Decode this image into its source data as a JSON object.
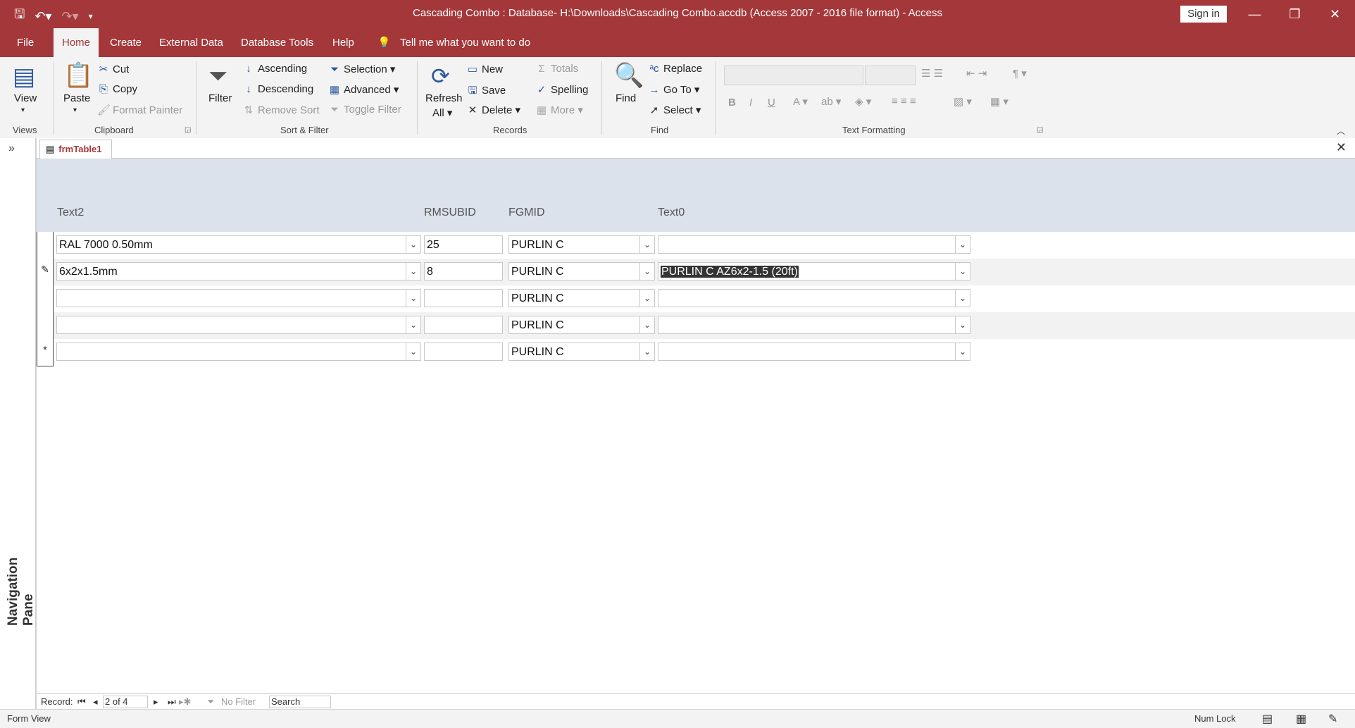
{
  "window": {
    "title": "Cascading Combo : Database- H:\\Downloads\\Cascading Combo.accdb (Access 2007 - 2016 file format)  -  Access",
    "sign_in": "Sign in"
  },
  "menu": {
    "file": "File",
    "home": "Home",
    "create": "Create",
    "external_data": "External Data",
    "database_tools": "Database Tools",
    "help": "Help",
    "tell_me": "Tell me what you want to do"
  },
  "ribbon": {
    "views": {
      "view": "View",
      "label": "Views"
    },
    "clipboard": {
      "paste": "Paste",
      "cut": "Cut",
      "copy": "Copy",
      "format_painter": "Format Painter",
      "label": "Clipboard"
    },
    "sort_filter": {
      "filter": "Filter",
      "ascending": "Ascending",
      "descending": "Descending",
      "remove_sort": "Remove Sort",
      "selection": "Selection",
      "advanced": "Advanced",
      "toggle_filter": "Toggle Filter",
      "label": "Sort & Filter"
    },
    "records": {
      "refresh": "Refresh",
      "refresh_all": "All",
      "new": "New",
      "save": "Save",
      "delete": "Delete",
      "totals": "Totals",
      "spelling": "Spelling",
      "more": "More",
      "label": "Records"
    },
    "find": {
      "find": "Find",
      "replace": "Replace",
      "goto": "Go To",
      "select": "Select",
      "label": "Find"
    },
    "text_formatting": {
      "label": "Text Formatting"
    }
  },
  "nav_pane": {
    "label": "Navigation Pane"
  },
  "document": {
    "tab": "frmTable1"
  },
  "form": {
    "headers": [
      "Text2",
      "RMSUBID",
      "FGMID",
      "Text0"
    ],
    "rows": [
      {
        "selector": "",
        "text2": "RAL 7000 0.50mm",
        "rmsubid": "25",
        "fgmid": "PURLIN C",
        "text0": ""
      },
      {
        "selector": "✎",
        "text2": "6x2x1.5mm",
        "rmsubid": "8",
        "fgmid": "PURLIN C",
        "text0": "PURLIN C AZ6x2-1.5 (20ft)"
      },
      {
        "selector": "",
        "text2": "",
        "rmsubid": "",
        "fgmid": "PURLIN C",
        "text0": ""
      },
      {
        "selector": "",
        "text2": "",
        "rmsubid": "",
        "fgmid": "PURLIN C",
        "text0": ""
      },
      {
        "selector": "*",
        "text2": "",
        "rmsubid": "",
        "fgmid": "PURLIN C",
        "text0": ""
      }
    ]
  },
  "record_nav": {
    "label": "Record:",
    "position": "2 of 4",
    "filter": "No Filter",
    "search": "Search"
  },
  "status": {
    "view": "Form View",
    "num_lock": "Num Lock"
  }
}
